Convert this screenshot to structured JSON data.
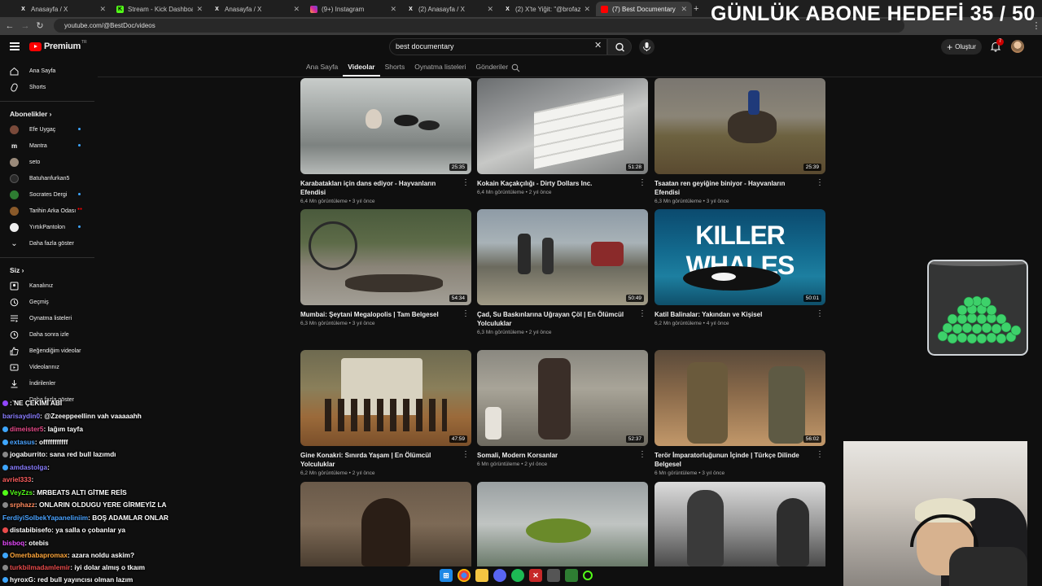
{
  "browser": {
    "tabs": [
      {
        "title": "Anasayfa / X",
        "icon": "x-icon",
        "active": false
      },
      {
        "title": "Stream - Kick Dashboard",
        "icon": "kick-icon",
        "active": false
      },
      {
        "title": "Anasayfa / X",
        "icon": "x-icon",
        "active": false
      },
      {
        "title": "(9+) Instagram",
        "icon": "instagram-icon",
        "active": false
      },
      {
        "title": "(2) Anasayfa / X",
        "icon": "x-icon",
        "active": false
      },
      {
        "title": "(2) X'te Yiğit: \"@brofazz Brofaz",
        "icon": "x-icon",
        "active": false
      },
      {
        "title": "(7) Best Documentary - YouTub",
        "icon": "youtube-icon",
        "active": true
      }
    ],
    "url": "youtube.com/@BestDoc/videos"
  },
  "overlay": {
    "goal_text": "GÜNLÜK ABONE HEDEFİ 35 / 50"
  },
  "header": {
    "logo_text": "Premium",
    "logo_region": "TR",
    "search_value": "best documentary",
    "create_label": "Oluştur",
    "notification_count": "7"
  },
  "channel_tabs": [
    "Ana Sayfa",
    "Videolar",
    "Shorts",
    "Oynatma listeleri",
    "Gönderiler"
  ],
  "active_channel_tab": "Videolar",
  "sidebar": {
    "top": [
      {
        "label": "Ana Sayfa",
        "icon": "home-icon"
      },
      {
        "label": "Shorts",
        "icon": "shorts-icon"
      }
    ],
    "subs_heading": "Abonelikler",
    "subscriptions": [
      {
        "label": "Efe Uygaç",
        "avatar_color": "#7a4a3a",
        "dot": true
      },
      {
        "label": "Mantra",
        "avatar_color": "#111111",
        "dot": true
      },
      {
        "label": "seto",
        "avatar_color": "#9a8a7a",
        "dot": false
      },
      {
        "label": "Batuhanfurkan5",
        "avatar_color": "#2a2a2a",
        "dot": false
      },
      {
        "label": "Socrates Dergi",
        "avatar_color": "#2e7d32",
        "dot": true
      },
      {
        "label": "Tarihin Arka Odası",
        "avatar_color": "#8a5a2a",
        "live": true
      },
      {
        "label": "YırtıkPantolon",
        "avatar_color": "#eeeeee",
        "dot": true
      }
    ],
    "show_more": "Daha fazla göster",
    "you_heading": "Siz",
    "you_items": [
      {
        "label": "Kanalınız",
        "icon": "channel-icon"
      },
      {
        "label": "Geçmiş",
        "icon": "history-icon"
      },
      {
        "label": "Oynatma listeleri",
        "icon": "playlists-icon"
      },
      {
        "label": "Daha sonra izle",
        "icon": "watch-later-icon"
      },
      {
        "label": "Beğendiğim videolar",
        "icon": "liked-icon"
      },
      {
        "label": "Videolarınız",
        "icon": "your-videos-icon"
      },
      {
        "label": "İndirilenler",
        "icon": "downloads-icon"
      },
      {
        "label": "Daha fazla göster",
        "icon": "chevron-down-icon"
      }
    ]
  },
  "videos": [
    {
      "title": "Karabatakları için dans ediyor - Hayvanların Efendisi",
      "meta": "6,4 Mn görüntüleme • 3 yıl önce",
      "duration": "25:35"
    },
    {
      "title": "Kokain Kaçakçılığı - Dirty Dollars Inc.",
      "meta": "6,4 Mn görüntüleme • 2 yıl önce",
      "duration": "51:28"
    },
    {
      "title": "Tsaatan ren geyiğine biniyor - Hayvanların Efendisi",
      "meta": "6,3 Mn görüntüleme • 3 yıl önce",
      "duration": "25:39"
    },
    {
      "title": "Mumbai: Şeytani Megalopolis | Tam Belgesel",
      "meta": "6,3 Mn görüntüleme • 3 yıl önce",
      "duration": "54:34"
    },
    {
      "title": "Çad, Su Baskınlarına Uğrayan Çöl | En Ölümcül Yolculuklar",
      "meta": "6,3 Mn görüntüleme • 2 yıl önce",
      "duration": "50:49"
    },
    {
      "title": "Katil Balinalar: Yakından ve Kişisel",
      "meta": "6,2 Mn görüntüleme • 4 yıl önce",
      "duration": "50:01",
      "thumb_text": "KILLER WHALES"
    },
    {
      "title": "Gine Konakri: Sınırda Yaşam | En Ölümcül Yolculuklar",
      "meta": "6,2 Mn görüntüleme • 2 yıl önce",
      "duration": "47:59"
    },
    {
      "title": "Somali, Modern Korsanlar",
      "meta": "6 Mn görüntüleme • 2 yıl önce",
      "duration": "52:37"
    },
    {
      "title": "Terör İmparatorluğunun İçinde | Türkçe Dilinde Belgesel",
      "meta": "6 Mn görüntüleme • 3 yıl önce",
      "duration": "56:02"
    }
  ],
  "chat": [
    {
      "user": "",
      "user_color": "#9146ff",
      "text": ": NE ÇEKİMİ ABİ"
    },
    {
      "user": "barisaydin0",
      "user_color": "#8a7dff",
      "text": ": @Zzeeppeellinn vah vaaaaahh"
    },
    {
      "user": "dimeister5",
      "user_color": "#e94b8a",
      "text": ": lağım tayfa"
    },
    {
      "user": "extasus",
      "user_color": "#4aa3ff",
      "text": ": offfffffffff"
    },
    {
      "user": "jogaburrito",
      "user_color": "#ffffff",
      "text": ": sana red bull lazımdı"
    },
    {
      "user": "amdastolga",
      "user_color": "#8a7dff",
      "text": ":"
    },
    {
      "user": "avriel333",
      "user_color": "#ff5e5e",
      "text": ":"
    },
    {
      "user": "VeyZzs",
      "user_color": "#53fc18",
      "text": ": MRBEATS ALTI GİTME REİS"
    },
    {
      "user": "srphazz",
      "user_color": "#ff8a5e",
      "text": ": ONLARIN OLDUGU YERE GİRMEYİZ LA"
    },
    {
      "user": "FerdiyiSolbekYapaneliniim",
      "user_color": "#4aa3ff",
      "text": ": BOŞ ADAMLAR ONLAR"
    },
    {
      "user": "distabibisefo",
      "user_color": "#ffffff",
      "text": ": ya salla o çobanlar ya"
    },
    {
      "user": "bisboq",
      "user_color": "#e94bff",
      "text": ": otebis"
    },
    {
      "user": "Omerbabapromax",
      "user_color": "#ffa63a",
      "text": ": azara noldu askim?"
    },
    {
      "user": "turkbilmadamlemir",
      "user_color": "#e94b4b",
      "text": ": iyi dolar almış o tkaım"
    },
    {
      "user": "hyroxG",
      "user_color": "#ffffff",
      "text": ": red bull yayıncısı olman lazım"
    }
  ]
}
